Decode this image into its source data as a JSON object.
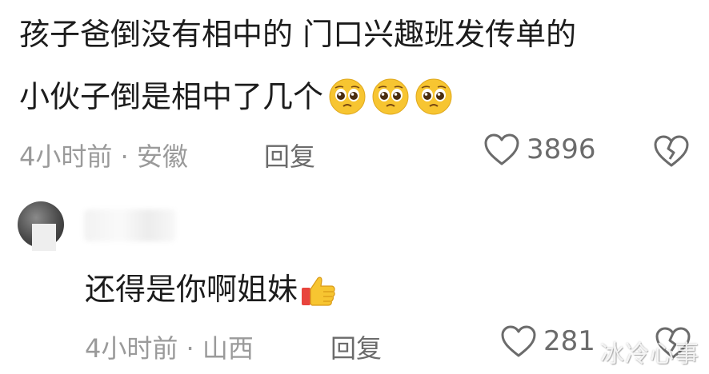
{
  "comment1": {
    "line1": "孩子爸倒没有相中的 门口兴趣班发传单的",
    "line2": "小伙子倒是相中了几个",
    "emojis": [
      "pleading-face-icon",
      "pleading-face-icon",
      "pleading-face-icon"
    ],
    "time_location": "4小时前 · 安徽",
    "reply_label": "回复",
    "like_count": "3896"
  },
  "comment2": {
    "text": "还得是你啊姐妹",
    "emoji": "thumbs-up-icon",
    "time_location": "4小时前 · 山西",
    "reply_label": "回复",
    "like_count": "281"
  },
  "watermark": "冰冷心事",
  "colors": {
    "text_primary": "#1c1c1c",
    "text_meta": "#9a9a9a",
    "text_action": "#6b6b6b",
    "emoji_yellow": "#f7c531"
  }
}
